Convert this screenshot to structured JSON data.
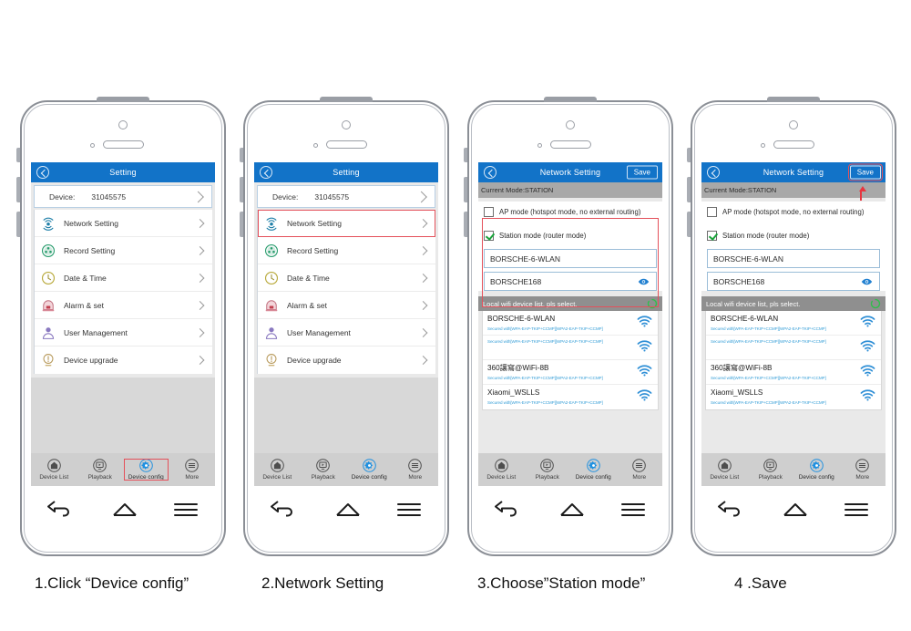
{
  "captions": [
    "1.Click “Device config”",
    "2.Network Setting",
    "3.Choose”Station mode”",
    "4 .Save"
  ],
  "colors": {
    "navbar_blue": "#1273c8",
    "highlight_red": "#e4505a",
    "check_green": "#19a33a",
    "wifi_blue": "#2f8fd6",
    "secured_text": "#39a0d8"
  },
  "setting_screen": {
    "nav_title": "Setting",
    "back_icon": "back-chevron-circle-icon",
    "device": {
      "label": "Device:",
      "value": "31045575"
    },
    "menu_items": [
      {
        "label": "Network Setting",
        "icon": "wifi-broadcast-icon"
      },
      {
        "label": "Record Setting",
        "icon": "film-reel-icon"
      },
      {
        "label": "Date & Time",
        "icon": "clock-icon"
      },
      {
        "label": "Alarm & set",
        "icon": "alarm-bell-icon"
      },
      {
        "label": "User Management",
        "icon": "user-icon"
      },
      {
        "label": "Device upgrade",
        "icon": "warning-upgrade-icon"
      }
    ]
  },
  "network_screen": {
    "nav_title": "Network Setting",
    "save_label": "Save",
    "current_mode": "Current Mode:STATION",
    "ap_mode": {
      "label": "AP mode (hotspot mode, no external routing)",
      "checked": false
    },
    "station_mode": {
      "label": "Station mode (router mode)",
      "checked": true
    },
    "ssid_field": "BORSCHE-6-WLAN",
    "password_field": "BORSCHE168",
    "password_eye_icon": "eye-icon",
    "wifi_list_header": "Local wifi device list, pls select.",
    "refresh_icon": "refresh-spinner-icon",
    "wifi_list": [
      {
        "ssid": "BORSCHE-6-WLAN",
        "security": "Secured with[WPA-EAP-TKIP+CCMP][WPA2-EAP-TKIP+CCMP]",
        "signal_icon": "wifi-signal-icon"
      },
      {
        "ssid": "",
        "security": "Secured with[WPA-EAP-TKIP+CCMP][WPA2-EAP-TKIP+CCMP]",
        "signal_icon": "wifi-signal-icon"
      },
      {
        "ssid": "360讓寫@WiFi-8B",
        "security": "Secured with[WPA-EAP-TKIP+CCMP][WPA2-EAP-TKIP+CCMP]",
        "signal_icon": "wifi-signal-icon"
      },
      {
        "ssid": "Xiaomi_WSLLS",
        "security": "Secured with[WPA-EAP-TKIP+CCMP][WPA2-EAP-TKIP+CCMP]",
        "signal_icon": "wifi-signal-icon"
      }
    ]
  },
  "tabbar": {
    "items": [
      {
        "label": "Device List",
        "icon": "home-icon"
      },
      {
        "label": "Playback",
        "icon": "monitor-play-icon"
      },
      {
        "label": "Device config",
        "icon": "gear-icon"
      },
      {
        "label": "More",
        "icon": "hamburger-circle-icon"
      }
    ]
  },
  "softkeys": [
    {
      "name": "back-softkey",
      "icon": "back-arrow-icon"
    },
    {
      "name": "home-softkey",
      "icon": "home-outline-icon"
    },
    {
      "name": "menu-softkey",
      "icon": "menu-lines-icon"
    }
  ]
}
